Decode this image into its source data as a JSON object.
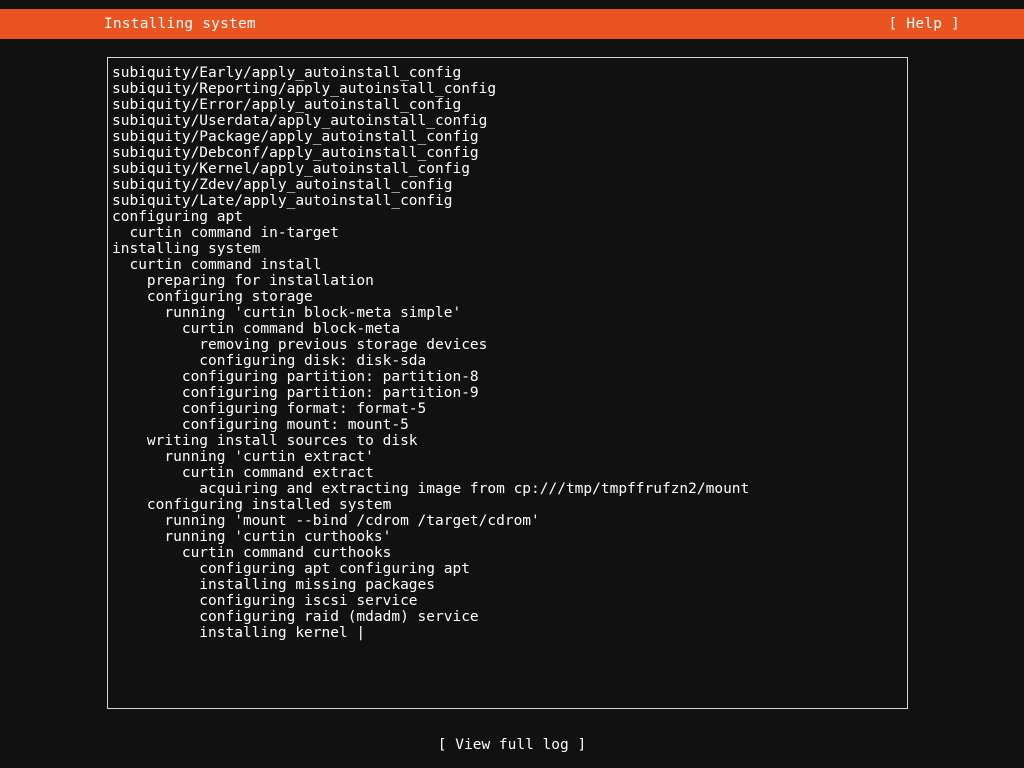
{
  "header": {
    "title": "Installing system",
    "help_label": "[ Help ]",
    "accent_color": "#e95420",
    "text_color": "#ffffff"
  },
  "screen": {
    "background_color": "#111111",
    "foreground_color": "#ffffff",
    "border_color": "#d8d8d8"
  },
  "log": {
    "lines": [
      "subiquity/Early/apply_autoinstall_config",
      "subiquity/Reporting/apply_autoinstall_config",
      "subiquity/Error/apply_autoinstall_config",
      "subiquity/Userdata/apply_autoinstall_config",
      "subiquity/Package/apply_autoinstall_config",
      "subiquity/Debconf/apply_autoinstall_config",
      "subiquity/Kernel/apply_autoinstall_config",
      "subiquity/Zdev/apply_autoinstall_config",
      "subiquity/Late/apply_autoinstall_config",
      "configuring apt",
      "  curtin command in-target",
      "installing system",
      "  curtin command install",
      "    preparing for installation",
      "    configuring storage",
      "      running 'curtin block-meta simple'",
      "        curtin command block-meta",
      "          removing previous storage devices",
      "          configuring disk: disk-sda",
      "        configuring partition: partition-8",
      "        configuring partition: partition-9",
      "        configuring format: format-5",
      "        configuring mount: mount-5",
      "    writing install sources to disk",
      "      running 'curtin extract'",
      "        curtin command extract",
      "          acquiring and extracting image from cp:///tmp/tmpffrufzn2/mount",
      "    configuring installed system",
      "      running 'mount --bind /cdrom /target/cdrom'",
      "      running 'curtin curthooks'",
      "        curtin command curthooks",
      "          configuring apt configuring apt",
      "          installing missing packages",
      "          configuring iscsi service",
      "          configuring raid (mdadm) service",
      "          installing kernel |"
    ]
  },
  "footer": {
    "view_full_log_label": "[ View full log ]"
  }
}
